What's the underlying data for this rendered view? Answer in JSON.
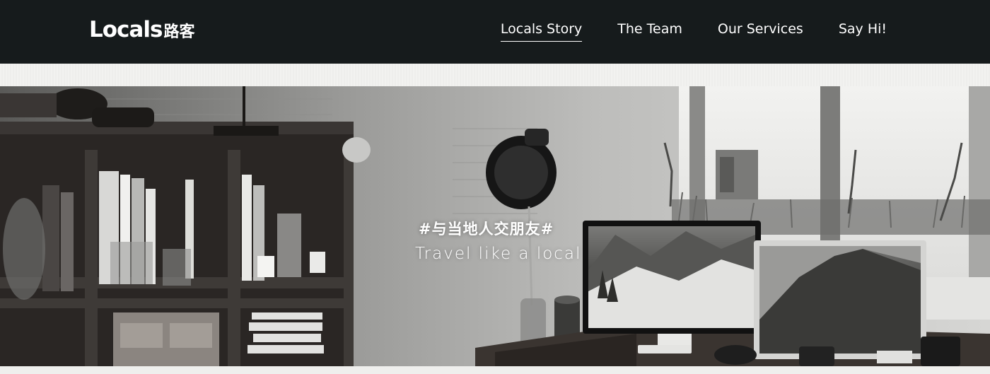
{
  "header": {
    "logo_text": "Locals",
    "logo_cn": "路客",
    "nav": [
      {
        "label": "Locals Story",
        "active": true
      },
      {
        "label": "The Team",
        "active": false
      },
      {
        "label": "Our Services",
        "active": false
      },
      {
        "label": "Say Hi!",
        "active": false
      }
    ]
  },
  "hero": {
    "hashtag": "#与当地人交朋友#",
    "tagline": "Travel like a local"
  },
  "colors": {
    "header_bg": "#161b1c",
    "text": "#ffffff"
  }
}
